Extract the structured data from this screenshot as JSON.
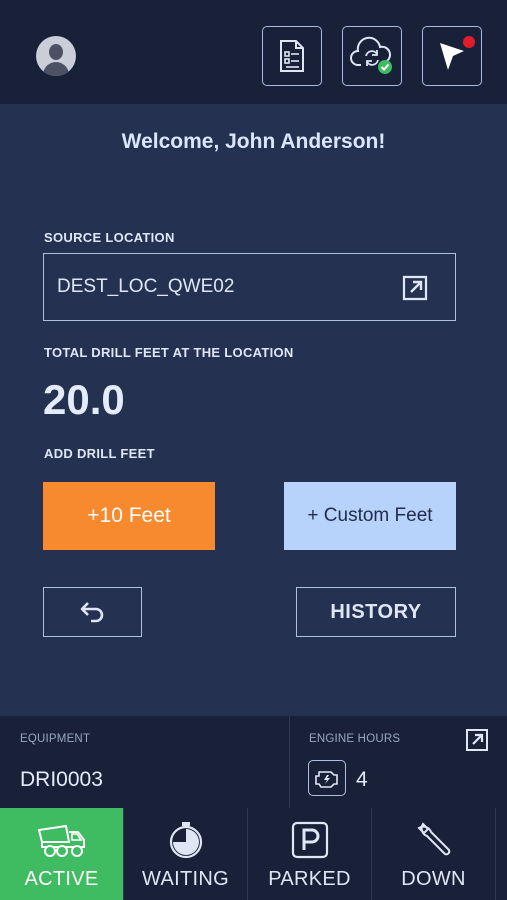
{
  "header": {
    "icons": [
      "avatar-icon",
      "report-icon",
      "cloud-sync-icon",
      "navigation-icon"
    ]
  },
  "welcome": "Welcome, John Anderson!",
  "source_location": {
    "label": "SOURCE LOCATION",
    "value": "DEST_LOC_QWE02"
  },
  "total_drill": {
    "label": "TOTAL DRILL FEET AT THE LOCATION",
    "value": "20.0"
  },
  "add_drill": {
    "label": "ADD DRILL FEET",
    "plus_ten_label": "+10 Feet",
    "custom_label": "+ Custom Feet"
  },
  "actions": {
    "history_label": "HISTORY"
  },
  "info": {
    "equipment_label": "EQUIPMENT",
    "equipment_value": "DRI0003",
    "engine_hours_label": "ENGINE HOURS",
    "engine_hours_value": "4"
  },
  "tabs": [
    {
      "label": "ACTIVE",
      "icon": "dump-truck-icon",
      "active": true
    },
    {
      "label": "WAITING",
      "icon": "timer-icon",
      "active": false
    },
    {
      "label": "PARKED",
      "icon": "parking-icon",
      "active": false
    },
    {
      "label": "DOWN",
      "icon": "wrench-icon",
      "active": false
    }
  ],
  "colors": {
    "background": "#243150",
    "bar": "#182138",
    "orange": "#f78a2e",
    "light_blue": "#b7d3fb",
    "active_green": "#3fbb61",
    "notification_red": "#e11d2b"
  }
}
